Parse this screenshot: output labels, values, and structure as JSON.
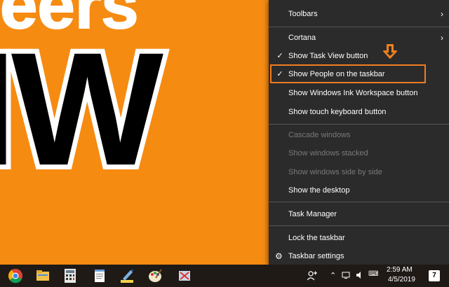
{
  "wallpaper": {
    "line1": "eers",
    "line2": "IW"
  },
  "menu": {
    "items": [
      {
        "label": "Toolbars",
        "submenu": true
      },
      {
        "label": "Cortana",
        "submenu": true
      },
      {
        "label": "Show Task View button",
        "checked": true
      },
      {
        "label": "Show People on the taskbar",
        "checked": true
      },
      {
        "label": "Show Windows Ink Workspace button"
      },
      {
        "label": "Show touch keyboard button"
      },
      {
        "label": "Cascade windows",
        "disabled": true
      },
      {
        "label": "Show windows stacked",
        "disabled": true
      },
      {
        "label": "Show windows side by side",
        "disabled": true
      },
      {
        "label": "Show the desktop"
      },
      {
        "label": "Task Manager"
      },
      {
        "label": "Lock the taskbar"
      },
      {
        "label": "Taskbar settings"
      }
    ],
    "check_glyph": "✓",
    "chevron_glyph": "›",
    "gear_glyph": "⚙"
  },
  "taskbar": {
    "clock_time": "2:59 AM",
    "clock_date": "4/5/2019",
    "notification_count": "7",
    "colors": {
      "highlight": "#ef7d22",
      "background": "#1f1a16"
    }
  }
}
